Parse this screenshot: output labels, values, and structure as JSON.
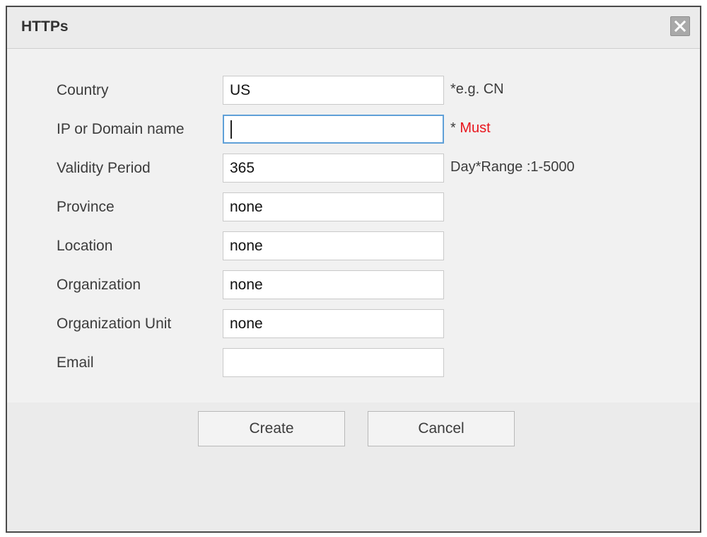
{
  "dialog": {
    "title": "HTTPs",
    "close_icon": "close-icon"
  },
  "fields": [
    {
      "label": "Country",
      "value": "US",
      "hint": "*e.g. CN"
    },
    {
      "label": "IP or Domain name",
      "value": "",
      "hint_prefix": "* ",
      "hint_must": "Must"
    },
    {
      "label": "Validity Period",
      "value": "365",
      "hint": "Day*Range :1-5000"
    },
    {
      "label": "Province",
      "value": "none"
    },
    {
      "label": "Location",
      "value": "none"
    },
    {
      "label": "Organization",
      "value": "none"
    },
    {
      "label": "Organization Unit",
      "value": "none"
    },
    {
      "label": "Email",
      "value": ""
    }
  ],
  "buttons": {
    "create": "Create",
    "cancel": "Cancel"
  },
  "colors": {
    "must": "#e8141c",
    "focus_border": "#5fa0d8"
  }
}
